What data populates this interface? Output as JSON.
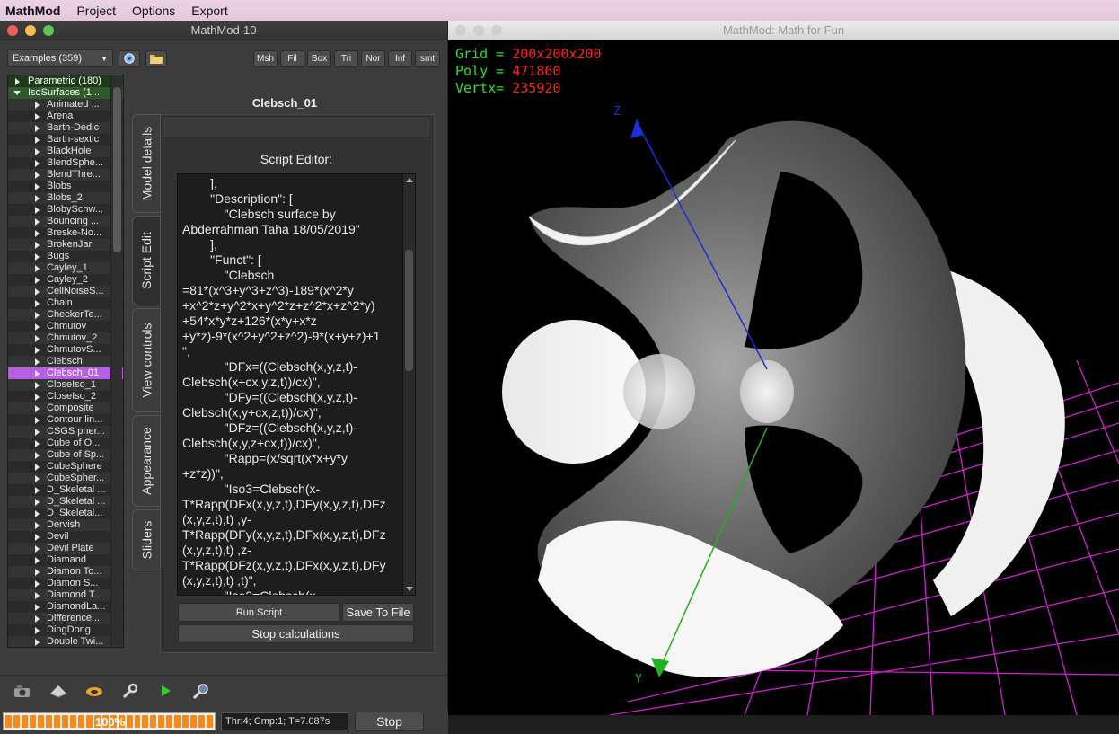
{
  "menubar": {
    "app": "MathMod",
    "items": [
      "Project",
      "Options",
      "Export"
    ]
  },
  "left_window": {
    "title": "MathMod-10",
    "examples_label": "Examples (359)",
    "toolbar_buttons": [
      "Msh",
      "Fil",
      "Box",
      "Tri",
      "Nor",
      "Inf",
      "smt"
    ],
    "model_title": "Clebsch_01",
    "tree": {
      "parametric": "Parametric (180)",
      "isosurfaces": "IsoSurfaces (1...",
      "items": [
        "Animated ...",
        "Arena",
        "Barth-Dedic",
        "Barth-sextic",
        "BlackHole",
        "BlendSphe...",
        "BlendThre...",
        "Blobs",
        "Blobs_2",
        "BlobySchw...",
        "Bouncing ...",
        "Breske-No...",
        "BrokenJar",
        "Bugs",
        "Cayley_1",
        "Cayley_2",
        "CellNoiseS...",
        "Chain",
        "CheckerTe...",
        "Chmutov",
        "Chmutov_2",
        "ChmutovS...",
        "Clebsch",
        "Clebsch_01",
        "CloseIso_1",
        "CloseIso_2",
        "Composite",
        "Contour lin...",
        "CSGS pher...",
        "Cube of O...",
        "Cube of Sp...",
        "CubeSphere",
        "CubeSpher...",
        "D_Skeletal ...",
        "D_Skeletal ...",
        "D_Skeletal...",
        "Dervish",
        "Devil",
        "Devil Plate",
        "Diamand",
        "Diamon To...",
        "Diamon S...",
        "Diamond T...",
        "DiamondLa...",
        "Difference...",
        "DingDong",
        "Double Twi..."
      ],
      "selected": "Clebsch_01"
    },
    "tabs": [
      "Model details",
      "Script Edit",
      "View controls",
      "Appearance",
      "Sliders"
    ],
    "active_tab": "Script Edit",
    "editor": {
      "label": "Script Editor:",
      "text": "        ],\n        \"Description\": [\n            \"Clebsch surface by\nAbderrahman Taha 18/05/2019\"\n        ],\n        \"Funct\": [\n            \"Clebsch\n=81*(x^3+y^3+z^3)-189*(x^2*y\n+x^2*z+y^2*x+y^2*z+z^2*x+z^2*y)\n+54*x*y*z+126*(x*y+x*z\n+y*z)-9*(x^2+y^2+z^2)-9*(x+y+z)+1\n\",\n            \"DFx=((Clebsch(x,y,z,t)-\nClebsch(x+cx,y,z,t))/cx)\",\n            \"DFy=((Clebsch(x,y,z,t)-\nClebsch(x,y+cx,z,t))/cx)\",\n            \"DFz=((Clebsch(x,y,z,t)-\nClebsch(x,y,z+cx,t))/cx)\",\n            \"Rapp=(x/sqrt(x*x+y*y\n+z*z))\",\n            \"Iso3=Clebsch(x-\nT*Rapp(DFx(x,y,z,t),DFy(x,y,z,t),DFz\n(x,y,z,t),t) ,y-\nT*Rapp(DFy(x,y,z,t),DFx(x,y,z,t),DFz\n(x,y,z,t),t) ,z-\nT*Rapp(DFz(x,y,z,t),DFx(x,y,z,t),DFy\n(x,y,z,t),t) ,t)\",\n            \"Iso2=Clebsch(x"
    },
    "run_script": "Run Script",
    "save_to_file": "Save To File",
    "stop_calculations": "Stop calculations",
    "progress": {
      "percent": 100,
      "label": "100%"
    },
    "status_text": "Thr:4; Cmp:1; T=7.087s",
    "stop": "Stop"
  },
  "right_window": {
    "title": "MathMod: Math for Fun",
    "hud": [
      {
        "label": "Grid =",
        "value": "200x200x200"
      },
      {
        "label": "Poly =",
        "value": "471860"
      },
      {
        "label": "Vertx=",
        "value": "235920"
      }
    ],
    "axis_z": "Z",
    "axis_y": "Y",
    "colors": {
      "grid": "#d020d0",
      "axis_z": "#1a2fd8",
      "axis_y": "#1fb21f",
      "hud_label": "#27e027",
      "hud_value": "#ff2020"
    }
  }
}
